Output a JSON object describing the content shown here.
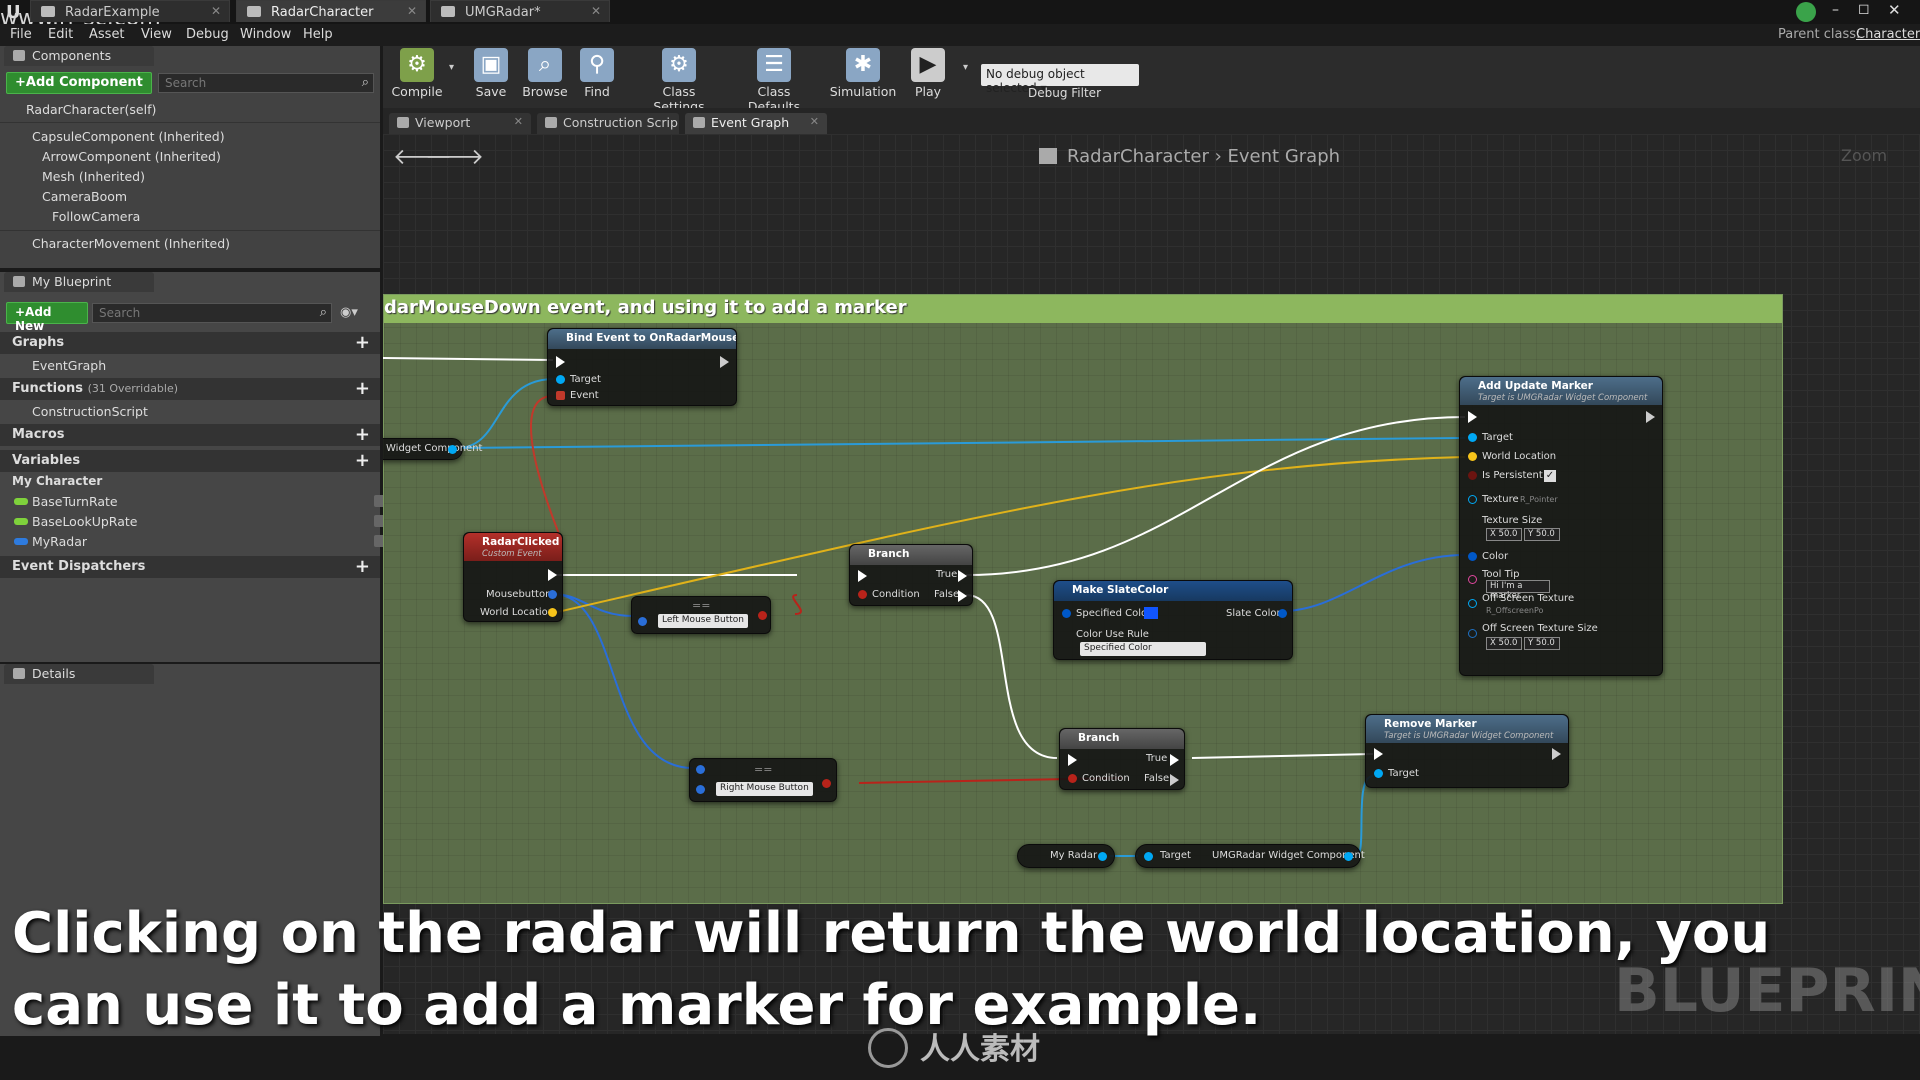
{
  "watermark_site": "www.rr-sc.com",
  "title_tabs": [
    {
      "label": "RadarExample"
    },
    {
      "label": "RadarCharacter"
    },
    {
      "label": "UMGRadar*"
    }
  ],
  "parent_class": {
    "label": "Parent class:",
    "value": "Character"
  },
  "menu": [
    "File",
    "Edit",
    "Asset",
    "View",
    "Debug",
    "Window",
    "Help"
  ],
  "components_panel": {
    "tab": "Components",
    "add_button": "+Add Component",
    "search_placeholder": "Search",
    "self_item": "RadarCharacter(self)",
    "tree": [
      "CapsuleComponent (Inherited)",
      "ArrowComponent (Inherited)",
      "Mesh (Inherited)",
      "CameraBoom",
      "FollowCamera",
      "CharacterMovement (Inherited)"
    ]
  },
  "my_blueprint": {
    "tab": "My Blueprint",
    "add_new": "+Add New",
    "search_placeholder": "Search",
    "graphs_header": "Graphs",
    "graph_item": "EventGraph",
    "functions_header": "Functions",
    "functions_count": "(31 Overridable)",
    "function_item": "ConstructionScript",
    "macros_header": "Macros",
    "variables_header": "Variables",
    "var_category": "My Character",
    "variables": [
      {
        "name": "BaseTurnRate",
        "color": "#7fd23c"
      },
      {
        "name": "BaseLookUpRate",
        "color": "#7fd23c"
      },
      {
        "name": "MyRadar",
        "color": "#2e7bde"
      }
    ],
    "dispatchers_header": "Event Dispatchers"
  },
  "details": {
    "tab": "Details"
  },
  "toolbar": {
    "buttons": [
      "Compile",
      "Save",
      "Browse",
      "Find",
      "Class Settings",
      "Class Defaults",
      "Simulation",
      "Play"
    ],
    "debug_select": "No debug object selected",
    "debug_filter": "Debug Filter"
  },
  "graph_tabs": [
    "Viewport",
    "Construction Scrip",
    "Event Graph"
  ],
  "breadcrumb": {
    "blueprint": "RadarCharacter",
    "graph": "Event Graph",
    "zoom": "Zoom"
  },
  "comment_text": "darMouseDown event, and using it to add a marker",
  "nodes": {
    "bind": {
      "title": "Bind Event to OnRadarMouseDown",
      "pins": [
        "Target",
        "Event"
      ]
    },
    "widget_component": "Widget Component",
    "radar_clicked": {
      "title": "RadarClicked",
      "subtitle": "Custom Event",
      "pins": [
        "Mousebutton",
        "World Location"
      ]
    },
    "left_mouse": {
      "op": "==",
      "value": "Left Mouse Button"
    },
    "right_mouse": {
      "op": "==",
      "value": "Right Mouse Button"
    },
    "branch1": {
      "title": "Branch",
      "pins": [
        "Condition",
        "True",
        "False"
      ]
    },
    "branch2": {
      "title": "Branch",
      "pins": [
        "Condition",
        "True",
        "False"
      ]
    },
    "make_slate": {
      "title": "Make SlateColor",
      "pins": [
        "Specified Color",
        "Color Use Rule",
        "Slate Color"
      ],
      "rule": "Specified Color"
    },
    "add_marker": {
      "title": "Add Update Marker",
      "subtitle": "Target is UMGRadar Widget Component",
      "pins": [
        "Target",
        "World Location",
        "Is Persistent",
        "Texture",
        "Texture Size",
        "Color",
        "Tool Tip",
        "Off Screen Texture",
        "Off Screen Texture Size"
      ],
      "texture": "R_Pointer",
      "tooltip": "Hi I'm a marker",
      "offscreen_texture": "R_OffscreenPo",
      "texture_size": [
        "50.0",
        "50.0"
      ],
      "offscreen_size": [
        "50.0",
        "50.0"
      ],
      "xy_labels": [
        "X",
        "Y"
      ]
    },
    "remove_marker": {
      "title": "Remove Marker",
      "subtitle": "Target is UMGRadar Widget Component",
      "pins": [
        "Target"
      ]
    },
    "my_radar": "My Radar",
    "get_component": {
      "pin": "Target",
      "label": "UMGRadar Widget Component"
    }
  },
  "subtitle": "Clicking on the radar will return the world location, you can use it to add a marker for example.",
  "watermark": "BLUEPRINT",
  "brand": "人人素材",
  "colors": {
    "exec": "#ffffff",
    "object": "#00a8f4",
    "vector": "#f7c41a",
    "bool": "#b8231a",
    "struct": "#0058c8",
    "comment": "#8db75e"
  }
}
